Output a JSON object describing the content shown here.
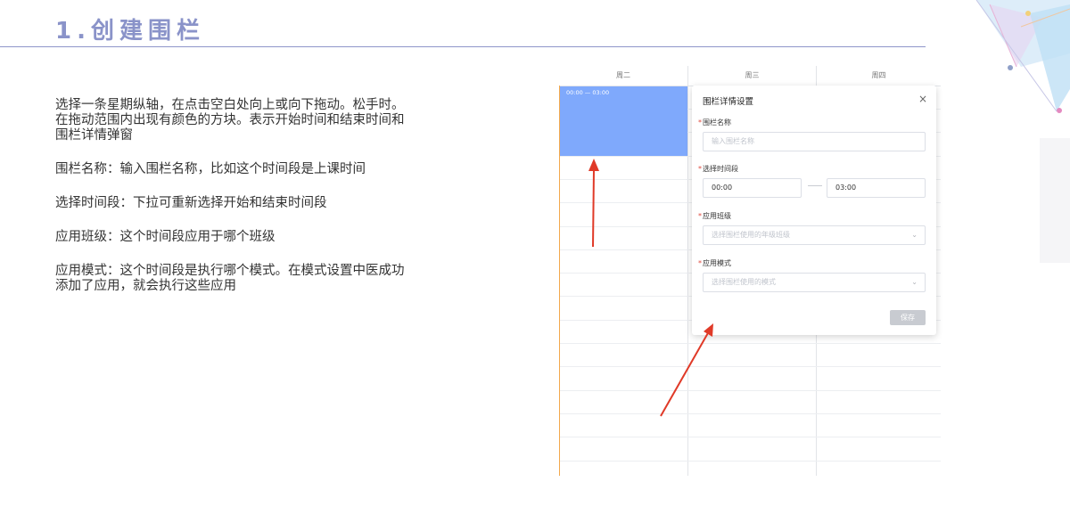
{
  "slide": {
    "title": "1.创建围栏"
  },
  "description": [
    "选择一条星期纵轴，在点击空白处向上或向下拖动。松手时。在拖动范围内出现有颜色的方块。表示开始时间和结束时间和围栏详情弹窗",
    "围栏名称：输入围栏名称，比如这个时间段是上课时间",
    "选择时间段：下拉可重新选择开始和结束时间段",
    "应用班级：这个时间段应用于哪个班级",
    "应用模式：这个时间段是执行哪个模式。在模式设置中医成功添加了应用，就会执行这些应用"
  ],
  "calendar": {
    "days": [
      "周二",
      "周三",
      "周四"
    ],
    "event_label": "00:00 — 03:00"
  },
  "modal": {
    "title": "围栏详情设置",
    "close": "×",
    "required_mark": "*",
    "name_label": "围栏名称",
    "name_placeholder": "输入围栏名称",
    "time_label": "选择时间段",
    "start_time": "00:00",
    "end_time": "03:00",
    "class_label": "应用班级",
    "class_placeholder": "选择围栏使用的年级班级",
    "mode_label": "应用模式",
    "mode_placeholder": "选择围栏使用的模式",
    "save_label": "保存"
  },
  "colors": {
    "title": "#8a93c9",
    "event_block": "#7fa9fc",
    "arrow": "#e03a28",
    "required": "#e04a3f"
  },
  "icons": {
    "close": "close-icon",
    "dropdown": "chevron-down-icon"
  }
}
